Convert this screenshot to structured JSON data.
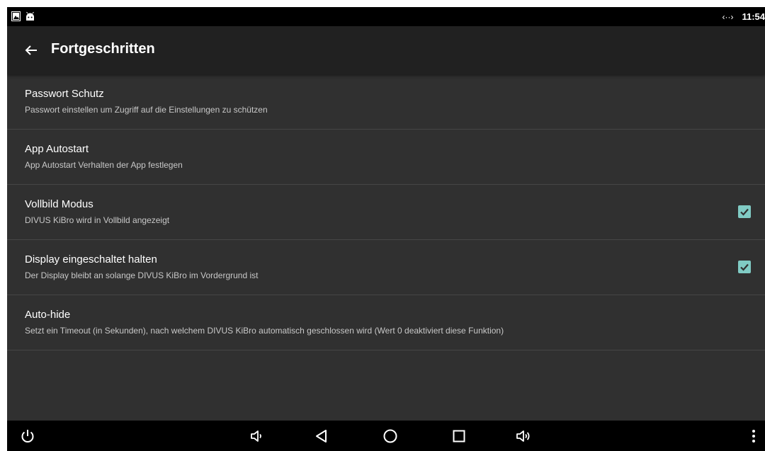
{
  "status_bar": {
    "left_icons": [
      "image-notification-icon",
      "android-debug-icon"
    ],
    "data_indicator": "‹··›",
    "time": "11:54"
  },
  "app_bar": {
    "back_icon": "arrow-back-icon",
    "title": "Fortgeschritten"
  },
  "preferences": [
    {
      "title": "Passwort Schutz",
      "summary": "Passwort einstellen um Zugriff auf die Einstellungen zu schützen",
      "has_checkbox": false
    },
    {
      "title": "App Autostart",
      "summary": "App Autostart Verhalten der App festlegen",
      "has_checkbox": false
    },
    {
      "title": "Vollbild Modus",
      "summary": "DIVUS KiBro wird in Vollbild angezeigt",
      "has_checkbox": true,
      "checked": true
    },
    {
      "title": "Display eingeschaltet halten",
      "summary": "Der Display bleibt an solange DIVUS KiBro im Vordergrund ist",
      "has_checkbox": true,
      "checked": true
    },
    {
      "title": "Auto-hide",
      "summary": "Setzt ein Timeout (in Sekunden), nach welchem DIVUS KiBro automatisch geschlossen wird (Wert 0 deaktiviert diese Funktion)",
      "has_checkbox": false
    }
  ],
  "nav_bar": {
    "buttons": [
      "power-icon",
      "volume-down-icon",
      "back-triangle-icon",
      "home-circle-icon",
      "recents-square-icon",
      "volume-up-icon",
      "overflow-menu-icon"
    ]
  },
  "colors": {
    "background": "#303030",
    "app_bar": "#212121",
    "status_bar": "#000000",
    "nav_bar": "#000000",
    "checkbox_accent": "#80cbc4",
    "divider": "#464646"
  }
}
